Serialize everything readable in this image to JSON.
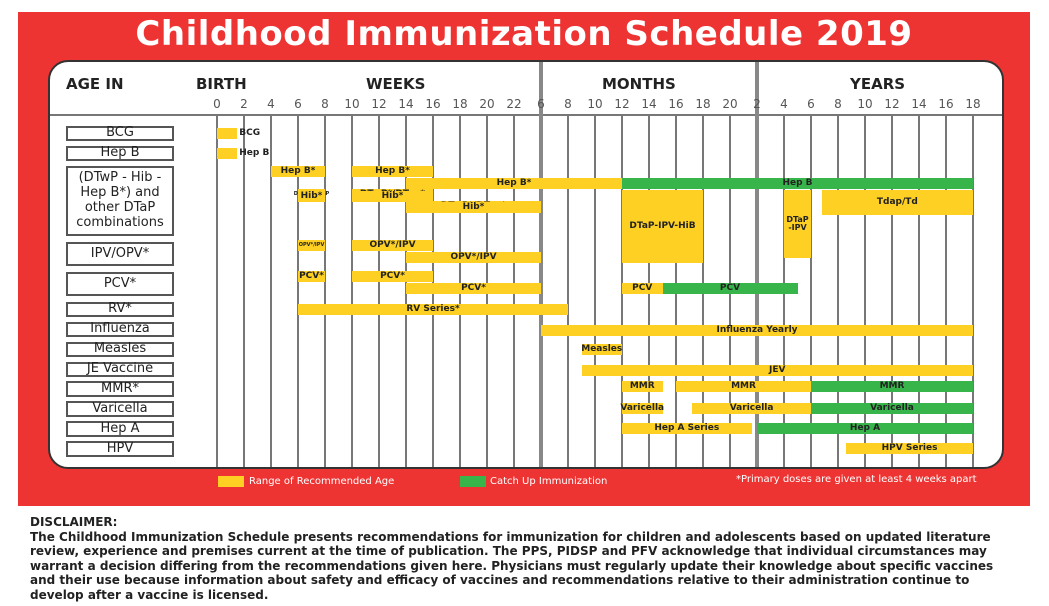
{
  "title": "Childhood Immunization Schedule 2019",
  "headers": {
    "age_in": "AGE IN",
    "birth": "BIRTH",
    "weeks": "WEEKS",
    "months": "MONTHS",
    "years": "YEARS"
  },
  "colors": {
    "recommended": "#fdd023",
    "catch_up": "#38b54a",
    "background": "#ee3433"
  },
  "chart_data": {
    "type": "gantt",
    "x_ticks": [
      "0",
      "2",
      "4",
      "6",
      "8",
      "10",
      "12",
      "14",
      "16",
      "18",
      "20",
      "22",
      "6",
      "8",
      "10",
      "12",
      "14",
      "16",
      "18",
      "20",
      "2",
      "4",
      "6",
      "8",
      "10",
      "12",
      "14",
      "16",
      "18"
    ],
    "x_units_note": "bar start/end expressed as tick index into x_ticks",
    "rows": [
      {
        "label": "BCG"
      },
      {
        "label": "Hep B"
      },
      {
        "label": "(DTwP - Hib - Hep B*) and other DTaP combinations"
      },
      {
        "label": "IPV/OPV*"
      },
      {
        "label": "PCV*"
      },
      {
        "label": "RV*"
      },
      {
        "label": "Influenza"
      },
      {
        "label": "Measles"
      },
      {
        "label": "JE Vaccine"
      },
      {
        "label": "MMR*"
      },
      {
        "label": "Varicella"
      },
      {
        "label": "Hep A"
      },
      {
        "label": "HPV"
      }
    ],
    "bars": [
      {
        "row": 0,
        "label": "BCG",
        "start": 0,
        "end": 0.75,
        "type": "recommended",
        "outside": true
      },
      {
        "row": 1,
        "label": "Hep B",
        "start": 0,
        "end": 0.75,
        "type": "recommended",
        "outside": true
      },
      {
        "row": 2,
        "label": "Hep B*",
        "start": 2,
        "end": 4,
        "type": "recommended",
        "lane": 0
      },
      {
        "row": 2,
        "label": "Hep B*",
        "start": 5,
        "end": 8,
        "type": "recommended",
        "lane": 0
      },
      {
        "row": 2,
        "label": "Hep B*",
        "start": 7,
        "end": 15,
        "type": "recommended",
        "lane": 1
      },
      {
        "row": 2,
        "label": "Hep B",
        "start": 15,
        "end": 28,
        "type": "catch_up",
        "lane": 1
      },
      {
        "row": 2,
        "label": "DTwP*/ DTaP",
        "start": 3,
        "end": 4,
        "type": "recommended",
        "lane": 2,
        "small": true
      },
      {
        "row": 2,
        "label": "DTwP*/DTap*",
        "start": 5,
        "end": 8,
        "type": "recommended",
        "lane": 2
      },
      {
        "row": 2,
        "label": "DTwP*/DTap*",
        "start": 7,
        "end": 12,
        "type": "recommended",
        "lane": 3
      },
      {
        "row": 2,
        "label": "Hib*",
        "start": 3,
        "end": 4,
        "type": "recommended",
        "lane": 4
      },
      {
        "row": 2,
        "label": "Hib*",
        "start": 5,
        "end": 8,
        "type": "recommended",
        "lane": 4
      },
      {
        "row": 2,
        "label": "Hib*",
        "start": 7,
        "end": 12,
        "type": "recommended",
        "lane": 5
      },
      {
        "row": 2,
        "label": "DTaP-IPV-HiB",
        "start": 15,
        "end": 18,
        "type": "recommended",
        "lane": 2,
        "tall": "dtapipvhib"
      },
      {
        "row": 2,
        "label": "DTaP -IPV",
        "start": 21,
        "end": 22,
        "type": "recommended",
        "lane": 2,
        "tall": "dtapipv"
      },
      {
        "row": 2,
        "label": "Tdap/Td",
        "start": 22.4,
        "end": 28,
        "type": "recommended",
        "lane": 2,
        "tall": "tdap"
      },
      {
        "row": 3,
        "label": "OPV*/IPV",
        "start": 3,
        "end": 4,
        "type": "recommended",
        "lane": 0,
        "small": true
      },
      {
        "row": 3,
        "label": "OPV*/IPV",
        "start": 5,
        "end": 8,
        "type": "recommended",
        "lane": 0
      },
      {
        "row": 3,
        "label": "OPV*/IPV",
        "start": 7,
        "end": 12,
        "type": "recommended",
        "lane": 1
      },
      {
        "row": 4,
        "label": "PCV*",
        "start": 3,
        "end": 4,
        "type": "recommended",
        "lane": 0
      },
      {
        "row": 4,
        "label": "PCV*",
        "start": 5,
        "end": 8,
        "type": "recommended",
        "lane": 0
      },
      {
        "row": 4,
        "label": "PCV*",
        "start": 7,
        "end": 12,
        "type": "recommended",
        "lane": 1
      },
      {
        "row": 4,
        "label": "PCV",
        "start": 15,
        "end": 16.5,
        "type": "recommended",
        "lane": 1
      },
      {
        "row": 4,
        "label": "PCV",
        "start": 16.5,
        "end": 21.5,
        "type": "catch_up",
        "lane": 1
      },
      {
        "row": 5,
        "label": "RV Series*",
        "start": 3,
        "end": 13,
        "type": "recommended"
      },
      {
        "row": 6,
        "label": "Influenza Yearly",
        "start": 12,
        "end": 28,
        "type": "recommended"
      },
      {
        "row": 7,
        "label": "Measles",
        "start": 13.5,
        "end": 15,
        "type": "recommended"
      },
      {
        "row": 8,
        "label": "JEV",
        "start": 13.5,
        "end": 28,
        "type": "recommended"
      },
      {
        "row": 9,
        "label": "MMR",
        "start": 15,
        "end": 16.5,
        "type": "recommended"
      },
      {
        "row": 9,
        "label": "MMR",
        "start": 17,
        "end": 22,
        "type": "recommended"
      },
      {
        "row": 9,
        "label": "MMR",
        "start": 22,
        "end": 28,
        "type": "catch_up"
      },
      {
        "row": 10,
        "label": "Varicella",
        "start": 15,
        "end": 16.5,
        "type": "recommended"
      },
      {
        "row": 10,
        "label": "Varicella",
        "start": 17.6,
        "end": 22,
        "type": "recommended"
      },
      {
        "row": 10,
        "label": "Varicella",
        "start": 22,
        "end": 28,
        "type": "catch_up"
      },
      {
        "row": 11,
        "label": "Hep A Series",
        "start": 15,
        "end": 19.8,
        "type": "recommended"
      },
      {
        "row": 11,
        "label": "Hep A",
        "start": 20,
        "end": 28,
        "type": "catch_up"
      },
      {
        "row": 12,
        "label": "HPV Series",
        "start": 23.3,
        "end": 28,
        "type": "recommended"
      }
    ],
    "legend": [
      {
        "label": "Range of Recommended Age",
        "type": "recommended"
      },
      {
        "label": "Catch Up Immunization",
        "type": "catch_up"
      }
    ],
    "note": "*Primary doses are given at least 4 weeks apart"
  },
  "disclaimer": {
    "heading": "DISCLAIMER:",
    "text": "The Childhood Immunization Schedule presents recommendations for immunization for children and adolescents based on updated literature review, experience and premises current at the time of publication. The PPS, PIDSP and PFV acknowledge that individual circumstances may warrant a decision differing from the recommendations given here. Physicians must regularly update their knowledge about specific vaccines and their use because information about safety and efficacy of vaccines and recommendations relative to their administration continue to develop after a vaccine is licensed."
  }
}
